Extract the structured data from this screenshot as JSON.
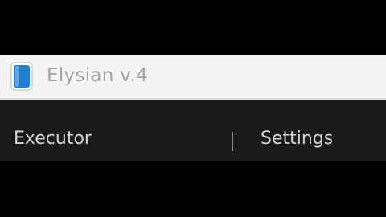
{
  "window": {
    "title": "Elysian v.4",
    "icon": "app-logo-icon"
  },
  "menu": {
    "tabs": [
      {
        "label": "Executor"
      },
      {
        "label": "Settings"
      }
    ]
  },
  "colors": {
    "titlebar_bg": "#f4f4f4",
    "title_text": "#a3a3a3",
    "menubar_bg": "#1a1a1a",
    "tab_text": "#d4d4d4",
    "icon_blue": "#1e7fd6",
    "background": "#000000"
  }
}
